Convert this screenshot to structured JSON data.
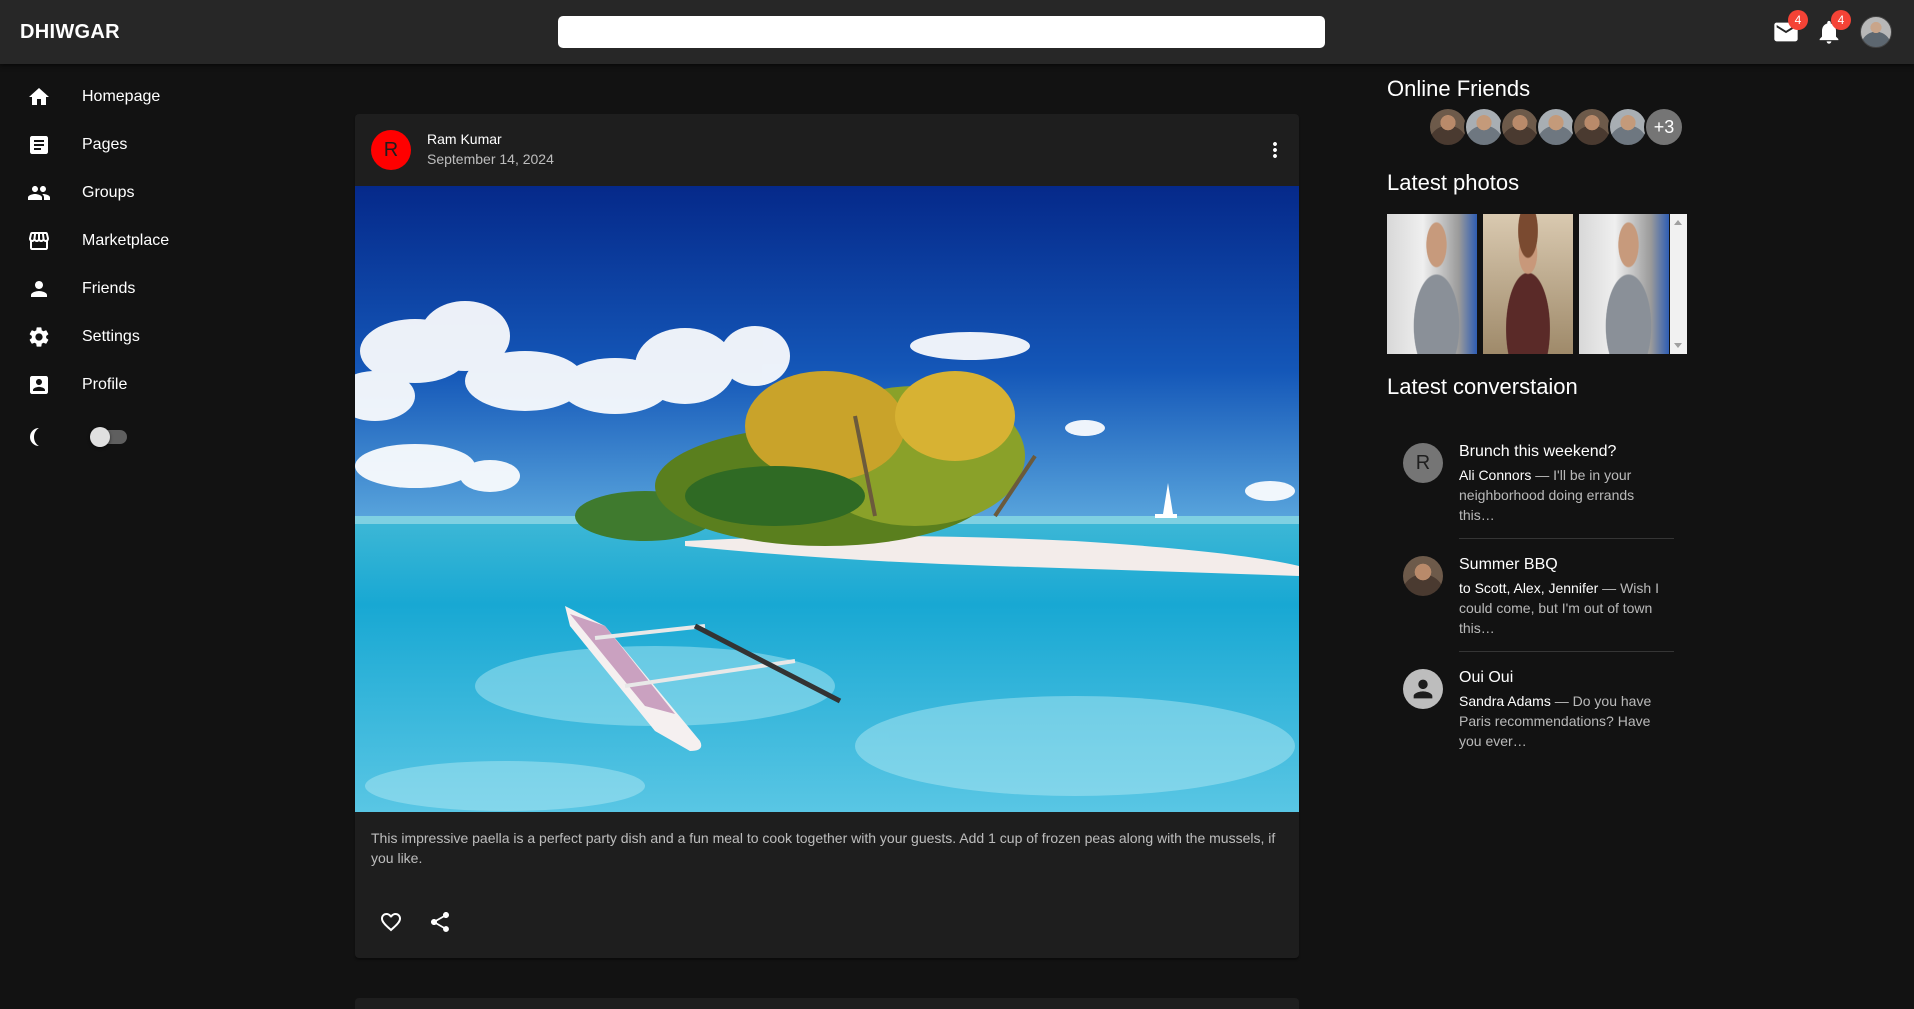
{
  "app": {
    "title": "DHIWGAR"
  },
  "search": {
    "placeholder": ""
  },
  "header": {
    "mail_badge": "4",
    "notifications_badge": "4",
    "icons": [
      "mail-icon",
      "notifications-icon",
      "avatar"
    ]
  },
  "sidebar": {
    "items": [
      {
        "label": "Homepage",
        "icon": "home-icon"
      },
      {
        "label": "Pages",
        "icon": "article-icon"
      },
      {
        "label": "Groups",
        "icon": "group-icon"
      },
      {
        "label": "Marketplace",
        "icon": "storefront-icon"
      },
      {
        "label": "Friends",
        "icon": "person-icon"
      },
      {
        "label": "Settings",
        "icon": "gear-icon"
      },
      {
        "label": "Profile",
        "icon": "account-box-icon"
      }
    ],
    "theme_icon": "dark-mode-moon-icon",
    "theme_toggle_on": false
  },
  "post": {
    "avatar_letter": "R",
    "author": "Ram Kumar",
    "date": "September 14, 2024",
    "image": "tropical-island-with-canoe",
    "body": "This impressive paella is a perfect party dish and a fun meal to cook together with your guests. Add 1 cup of frozen peas along with the mussels, if you like.",
    "actions": [
      "favorite-icon",
      "share-icon"
    ]
  },
  "right_panel": {
    "online_title": "Online Friends",
    "online_more": "+3",
    "photos_title": "Latest photos",
    "conversations_title": "Latest converstaion",
    "conversations": [
      {
        "avatar_letter": "R",
        "title": "Brunch this weekend?",
        "who": "Ali Connors",
        "text": " — I'll be in your neighborhood doing errands this…"
      },
      {
        "avatar_letter": "",
        "title": "Summer BBQ",
        "who": "to Scott, Alex, Jennifer",
        "text": " — Wish I could come, but I'm out of town this…"
      },
      {
        "avatar_letter": "",
        "title": "Oui Oui",
        "who": "Sandra Adams",
        "text": " — Do you have Paris recommendations? Have you ever…"
      }
    ]
  },
  "colors": {
    "background": "#121212",
    "appbar": "#272727",
    "card": "#1e1e1e",
    "badge": "#f44336",
    "post_avatar": "#ff0000"
  }
}
